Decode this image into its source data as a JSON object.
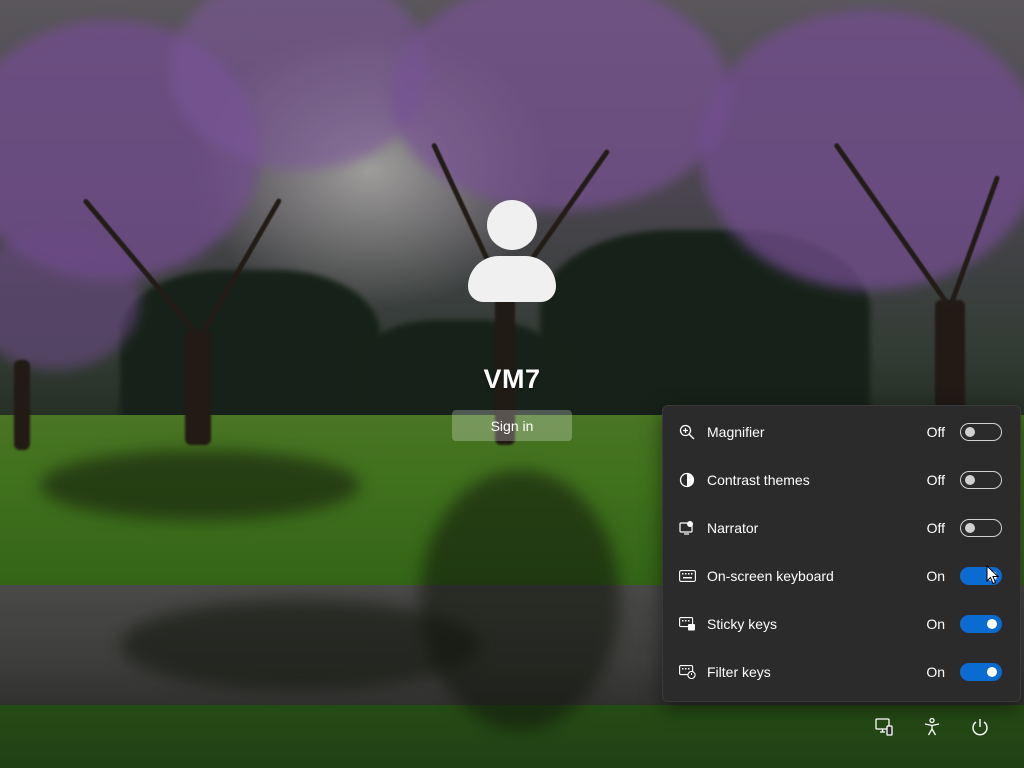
{
  "login": {
    "username": "VM7",
    "sign_in_label": "Sign in"
  },
  "accessibility": {
    "items": [
      {
        "label": "Magnifier",
        "state": "Off",
        "icon": "magnifier-icon",
        "on": false
      },
      {
        "label": "Contrast themes",
        "state": "Off",
        "icon": "contrast-icon",
        "on": false
      },
      {
        "label": "Narrator",
        "state": "Off",
        "icon": "narrator-icon",
        "on": false
      },
      {
        "label": "On-screen keyboard",
        "state": "On",
        "icon": "keyboard-icon",
        "on": true
      },
      {
        "label": "Sticky keys",
        "state": "On",
        "icon": "sticky-keys-icon",
        "on": true
      },
      {
        "label": "Filter keys",
        "state": "On",
        "icon": "filter-keys-icon",
        "on": true
      }
    ]
  },
  "tray": {
    "icons": [
      "network-icon",
      "accessibility-icon",
      "power-icon"
    ]
  },
  "colors": {
    "panel_bg": "#2b2b2b",
    "toggle_on": "#0a6bd0",
    "text": "#ffffff"
  }
}
